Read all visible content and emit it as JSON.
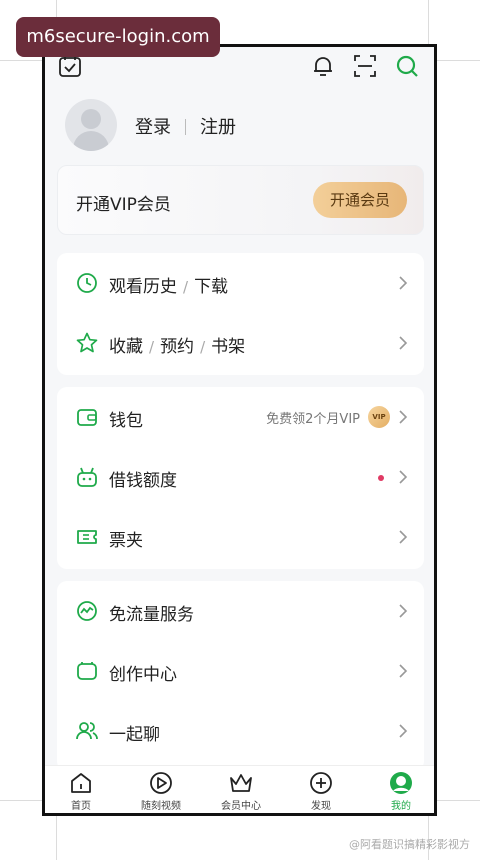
{
  "overlay": {
    "url": "m6secure-login.com"
  },
  "profile": {
    "login": "登录",
    "register": "注册"
  },
  "vip": {
    "title": "开通VIP会员",
    "button": "开通会员"
  },
  "group1": [
    {
      "icon": "clock-icon",
      "parts": [
        "观看历史",
        "下载"
      ]
    },
    {
      "icon": "star-icon",
      "parts": [
        "收藏",
        "预约",
        "书架"
      ]
    }
  ],
  "group2": [
    {
      "icon": "wallet-icon",
      "label": "钱包",
      "extra": "免费领2个月VIP",
      "badge": "VIP"
    },
    {
      "icon": "credit-icon",
      "label": "借钱额度"
    },
    {
      "icon": "ticket-icon",
      "label": "票夹"
    }
  ],
  "group3": [
    {
      "icon": "traffic-icon",
      "label": "免流量服务"
    },
    {
      "icon": "creator-icon",
      "label": "创作中心"
    },
    {
      "icon": "chat-icon",
      "label": "一起聊"
    }
  ],
  "tabs": [
    {
      "label": "首页",
      "icon": "home-icon"
    },
    {
      "label": "随刻视频",
      "icon": "play-icon"
    },
    {
      "label": "会员中心",
      "icon": "crown-icon"
    },
    {
      "label": "发现",
      "icon": "plus-icon"
    },
    {
      "label": "我的",
      "icon": "profile-icon",
      "active": true
    }
  ],
  "watermark": "@阿看题识搞精彩影视方",
  "colors": {
    "accent": "#1faa4a",
    "vip_gold": "#e7b678",
    "overlay": "#6b2d3b"
  }
}
